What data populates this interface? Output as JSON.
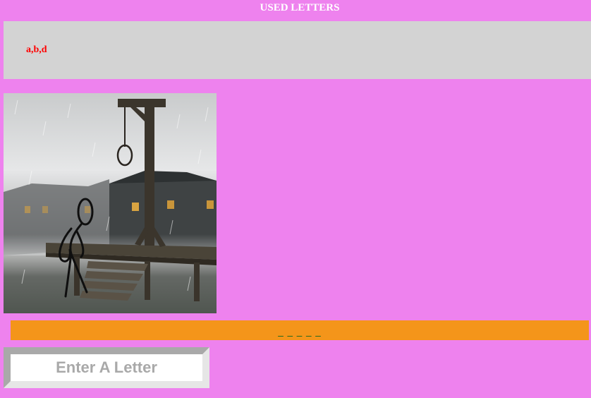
{
  "header": {
    "title": "USED LETTERS"
  },
  "used_letters": {
    "text": "a,b,d"
  },
  "scene": {
    "icon": "gallows-scene-icon"
  },
  "word": {
    "display": "_ _ _ _ _"
  },
  "input": {
    "placeholder": "Enter A Letter",
    "value": ""
  },
  "colors": {
    "background": "#ee82ee",
    "panel": "#d3d3d3",
    "used_letters_text": "#ff0000",
    "word_bar": "#f4951a",
    "word_text": "#2e6b1f"
  }
}
